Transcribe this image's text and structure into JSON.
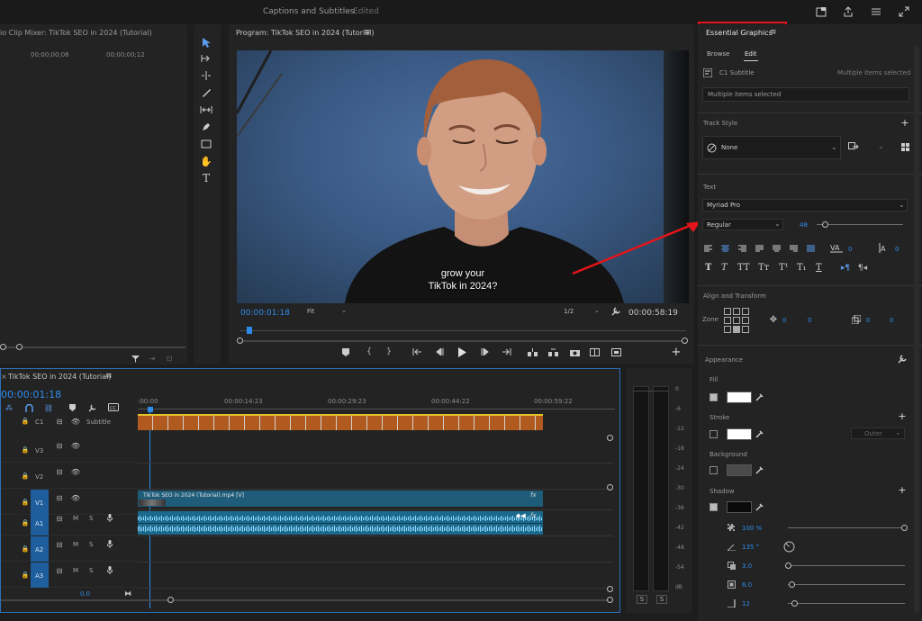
{
  "titlebar": {
    "title": "Captions and Subtitles",
    "status": "- Edited"
  },
  "audio_mixer": {
    "title": "io Clip Mixer: TikTok SEO in 2024 (Tutorial)",
    "ruler": [
      "00;00;00;06",
      "00;00;00;12"
    ]
  },
  "program": {
    "title": "Program: TikTok SEO in 2024 (Tutorial)",
    "caption_lines": [
      "grow your",
      "TikTok in 2024?"
    ],
    "timecode": "00:00:01:18",
    "fit": "Fit",
    "resolution": "1/2",
    "duration": "00:00:58:19"
  },
  "timeline": {
    "title": "TikTok SEO in 2024 (Tutorial)",
    "timecode": "00:00:01:18",
    "ruler": [
      ":00:00",
      "00:00:14:23",
      "00:00:29:23",
      "00:00:44:22",
      "00:00:59:22"
    ],
    "subtitle_track": {
      "id": "C1",
      "name": "Subtitle"
    },
    "tracks": [
      {
        "id": "V3"
      },
      {
        "id": "V2"
      },
      {
        "id": "V1"
      },
      {
        "id": "A1",
        "m": "M",
        "s": "S"
      },
      {
        "id": "A2",
        "m": "M",
        "s": "S"
      },
      {
        "id": "A3",
        "m": "M",
        "s": "S"
      }
    ],
    "clip_video": "TikTok SEO in 2024 (Tutorial).mp4 [V]",
    "fx": "fx",
    "volume": "0.0"
  },
  "meter": {
    "scale": [
      "0",
      "-6",
      "-12",
      "-18",
      "-24",
      "-30",
      "-36",
      "-42",
      "-48",
      "-54",
      "dB"
    ],
    "solo": [
      "S",
      "S"
    ]
  },
  "essential_graphics": {
    "title": "Essential Graphics",
    "tabs": [
      "Browse",
      "Edit"
    ],
    "layer": "C1 Subtitle",
    "layer_note": "Multiple items selected",
    "selection": "Multiple items selected",
    "track_style_label": "Track Style",
    "track_style_value": "None",
    "text_label": "Text",
    "font": "Myriad Pro",
    "font_style": "Regular",
    "font_size": "48",
    "kerning": "0",
    "leading": "0",
    "align_label": "Align and Transform",
    "zone_label": "Zone",
    "pos_x": "0",
    "pos_y": "0",
    "scale_x": "0",
    "scale_y": "0",
    "appearance_label": "Appearance",
    "fill_label": "Fill",
    "stroke_label": "Stroke",
    "stroke_type": "Outer",
    "background_label": "Background",
    "shadow_label": "Shadow",
    "shadow_opacity": "100 %",
    "shadow_angle": "135 °",
    "shadow_distance": "3.0",
    "shadow_size": "6.0",
    "shadow_blur": "12",
    "fill_color": "#ffffff",
    "shadow_color": "#0a0a0a"
  }
}
